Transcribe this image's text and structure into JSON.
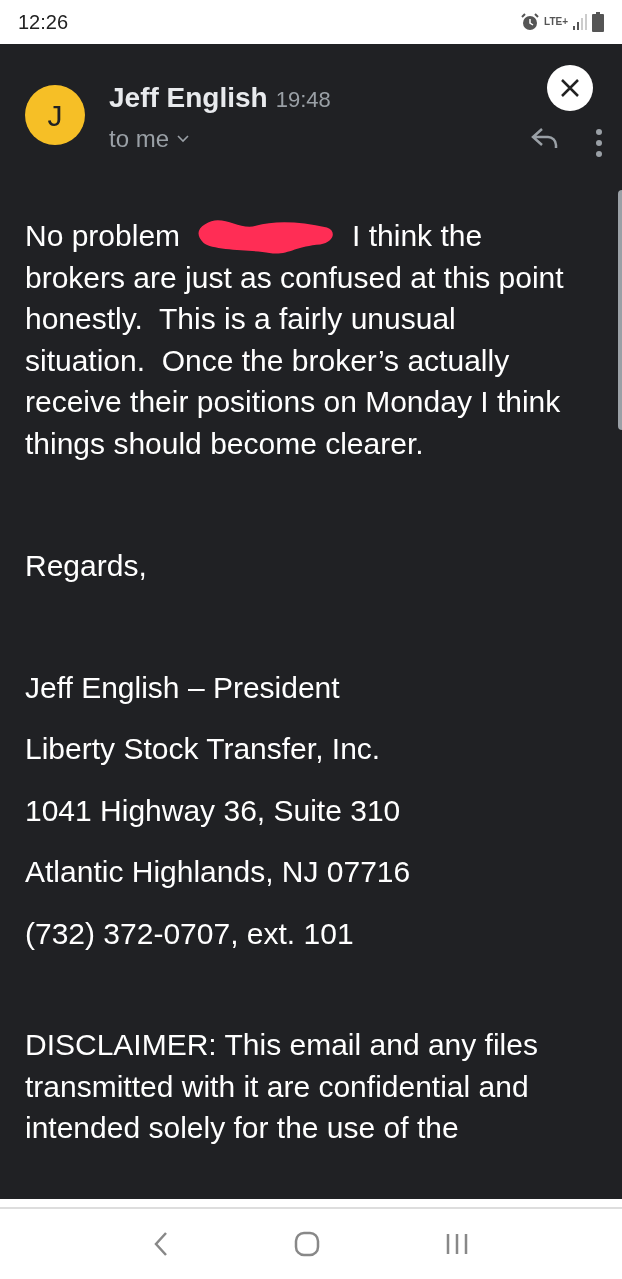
{
  "status_bar": {
    "time": "12:26",
    "network": "LTE+"
  },
  "message": {
    "avatar_letter": "J",
    "sender": "Jeff English",
    "time": "19:48",
    "recipient": "to me"
  },
  "body": {
    "before_redaction": "No problem",
    "after_redaction": "I think the",
    "continuation": "brokers are just as confused at this point honestly.  This is a fairly unusual situation.  Once the broker’s actually receive their positions on Monday I think things should become clearer.",
    "closing": "Regards,",
    "signature": [
      "Jeff English – President",
      "Liberty Stock Transfer, Inc.",
      "1041 Highway 36, Suite 310",
      "Atlantic Highlands, NJ 07716",
      "(732) 372-0707, ext. 101"
    ],
    "disclaimer": "DISCLAIMER: This email and any files transmitted with it are confidential and intended solely for the use of the"
  }
}
